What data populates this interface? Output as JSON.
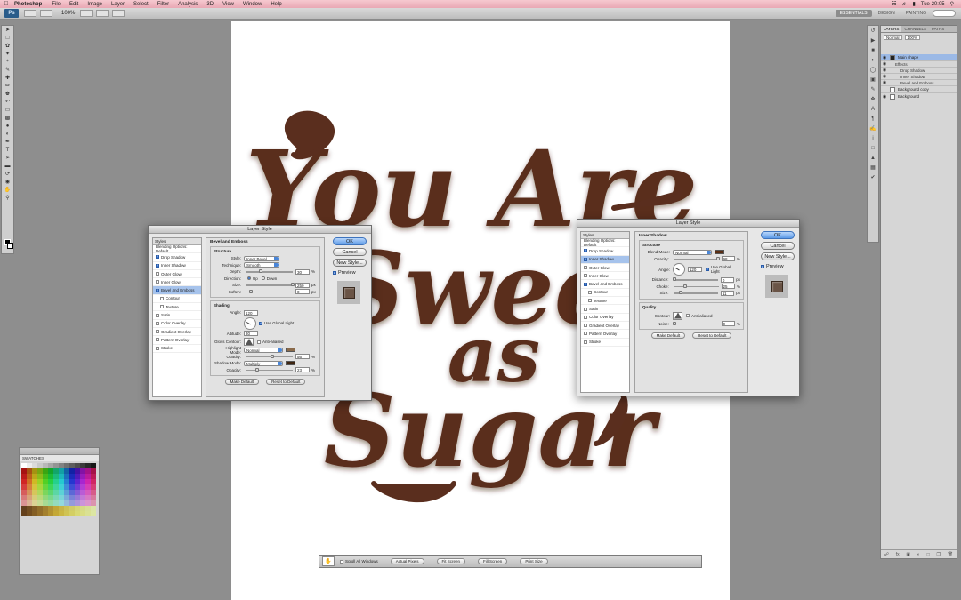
{
  "menubar": {
    "app_name": "Photoshop",
    "items": [
      "File",
      "Edit",
      "Image",
      "Layer",
      "Select",
      "Filter",
      "Analysis",
      "3D",
      "View",
      "Window",
      "Help"
    ],
    "clock": "Tue 20:05"
  },
  "appbar": {
    "logo": "Ps",
    "zoom": "100%",
    "workspaces": [
      "ESSENTIALS",
      "DESIGN",
      "PAINTING"
    ],
    "active_workspace": "ESSENTIALS"
  },
  "artwork": {
    "lines": [
      "You Are",
      "Sweet",
      "as",
      "Sugar"
    ],
    "color": "#5a2e1e"
  },
  "layers_panel": {
    "tabs": [
      "LAYERS",
      "CHANNELS",
      "PATHS"
    ],
    "blend_mode": "Normal",
    "opacity": "100%",
    "layers": [
      "Main shape",
      "Background copy",
      "Background"
    ],
    "effects_label": "Effects",
    "effects": [
      "Drop Shadow",
      "Inner Shadow",
      "Bevel and Emboss"
    ]
  },
  "swatches_panel": {
    "title": "SWATCHES"
  },
  "dialog_bevel": {
    "title": "Layer Style",
    "styles_header": "Styles",
    "blending_options": "Blending Options: Default",
    "styles": [
      {
        "label": "Drop Shadow",
        "checked": "true"
      },
      {
        "label": "Inner Shadow",
        "checked": "true"
      },
      {
        "label": "Outer Glow",
        "checked": "false"
      },
      {
        "label": "Inner Glow",
        "checked": "false"
      },
      {
        "label": "Bevel and Emboss",
        "checked": "true"
      },
      {
        "label": "Contour",
        "checked": "false"
      },
      {
        "label": "Texture",
        "checked": "false"
      },
      {
        "label": "Satin",
        "checked": "false"
      },
      {
        "label": "Color Overlay",
        "checked": "false"
      },
      {
        "label": "Gradient Overlay",
        "checked": "false"
      },
      {
        "label": "Pattern Overlay",
        "checked": "false"
      },
      {
        "label": "Stroke",
        "checked": "false"
      }
    ],
    "section_title": "Bevel and Emboss",
    "structure_title": "Structure",
    "style_label": "Style:",
    "style_value": "Inner Bevel",
    "technique_label": "Technique:",
    "technique_value": "Smooth",
    "depth_label": "Depth:",
    "depth_value": "30",
    "depth_pct": 30,
    "direction_label": "Direction:",
    "direction_up": "Up",
    "direction_down": "Down",
    "size_label": "Size:",
    "size_value": "250",
    "size_pct": 100,
    "soften_label": "Soften:",
    "soften_value": "0",
    "soften_pct": 10,
    "shading_title": "Shading",
    "angle_label": "Angle:",
    "angle_value": "120",
    "global_light": "Use Global Light",
    "altitude_label": "Altitude:",
    "altitude_value": "30",
    "gloss_label": "Gloss Contour:",
    "antialiased": "Anti-aliased",
    "highlight_label": "Highlight Mode:",
    "highlight_value": "Normal",
    "highlight_color": "#8a6a4a",
    "highlight_opacity_label": "Opacity:",
    "highlight_opacity_value": "56",
    "highlight_opacity_pct": 56,
    "shadow_label": "Shadow Mode:",
    "shadow_value": "Multiply",
    "shadow_color": "#3e2510",
    "shadow_opacity_label": "Opacity:",
    "shadow_opacity_value": "23",
    "shadow_opacity_pct": 23,
    "make_default": "Make Default",
    "reset_default": "Reset to Default",
    "ok": "OK",
    "cancel": "Cancel",
    "new_style": "New Style...",
    "preview": "Preview",
    "unit_px": "px",
    "unit_pct": "%"
  },
  "dialog_inner": {
    "title": "Layer Style",
    "styles_header": "Styles",
    "blending_options": "Blending Options: Default",
    "styles": [
      {
        "label": "Drop Shadow",
        "checked": "true"
      },
      {
        "label": "Inner Shadow",
        "checked": "true"
      },
      {
        "label": "Outer Glow",
        "checked": "false"
      },
      {
        "label": "Inner Glow",
        "checked": "false"
      },
      {
        "label": "Bevel and Emboss",
        "checked": "true"
      },
      {
        "label": "Contour",
        "checked": "false"
      },
      {
        "label": "Texture",
        "checked": "false"
      },
      {
        "label": "Satin",
        "checked": "false"
      },
      {
        "label": "Color Overlay",
        "checked": "false"
      },
      {
        "label": "Gradient Overlay",
        "checked": "false"
      },
      {
        "label": "Pattern Overlay",
        "checked": "false"
      },
      {
        "label": "Stroke",
        "checked": "false"
      }
    ],
    "section_title": "Inner Shadow",
    "structure_title": "Structure",
    "blend_label": "Blend Mode:",
    "blend_value": "Normal",
    "blend_color": "#5a2e14",
    "opacity_label": "Opacity:",
    "opacity_value": "98",
    "opacity_pct": 98,
    "angle_label": "Angle:",
    "angle_value": "120",
    "global_light": "Use Global Light",
    "distance_label": "Distance:",
    "distance_value": "0",
    "distance_pct": 2,
    "choke_label": "Choke:",
    "choke_value": "25",
    "choke_pct": 25,
    "size_label": "Size:",
    "size_value": "11",
    "size_pct": 15,
    "quality_title": "Quality",
    "contour_label": "Contour:",
    "antialiased": "Anti-aliased",
    "noise_label": "Noise:",
    "noise_value": "0",
    "noise_pct": 0,
    "make_default": "Make Default",
    "reset_default": "Reset to Default",
    "ok": "OK",
    "cancel": "Cancel",
    "new_style": "New Style...",
    "preview": "Preview",
    "unit_px": "px",
    "unit_pct": "%"
  },
  "zoombar": {
    "scroll_all": "Scroll All Windows",
    "actual_pixels": "Actual Pixels",
    "fit_screen": "Fit Screen",
    "fill_screen": "Fill Screen",
    "print_size": "Print Size"
  }
}
